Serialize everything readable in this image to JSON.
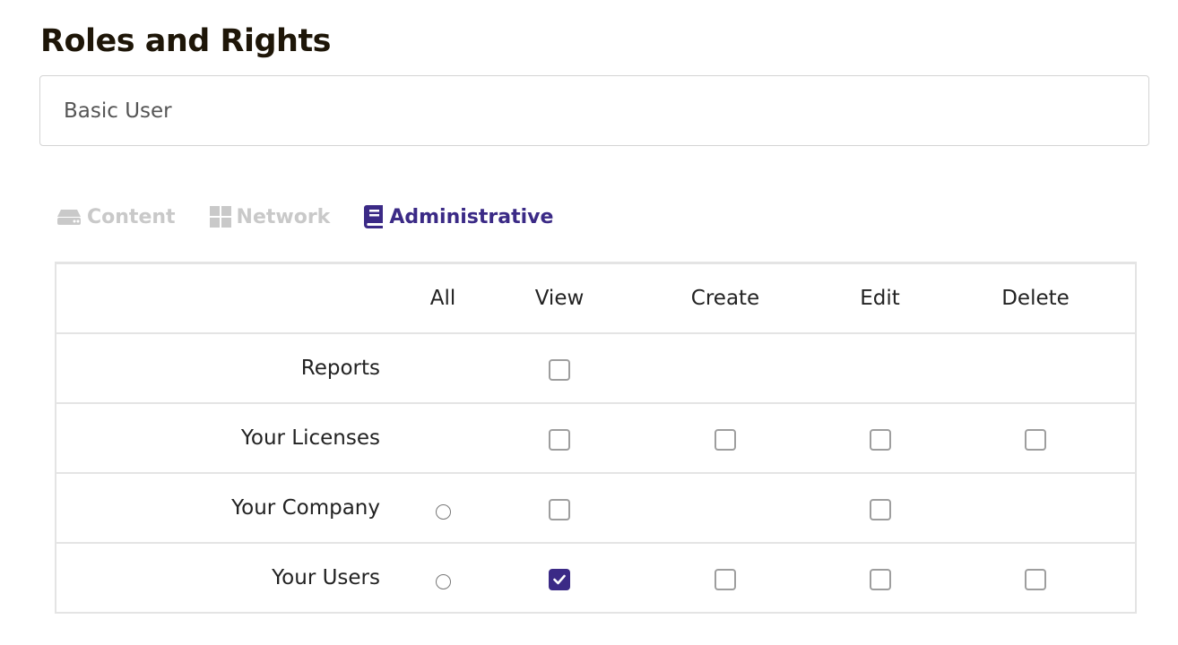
{
  "page": {
    "title": "Roles and Rights"
  },
  "role": {
    "value": "Basic User"
  },
  "tabs": [
    {
      "label": "Content",
      "icon": "hard-drive-icon",
      "active": false
    },
    {
      "label": "Network",
      "icon": "grid-icon",
      "active": false
    },
    {
      "label": "Administrative",
      "icon": "book-icon",
      "active": true
    }
  ],
  "colors": {
    "accent": "#3b2a86",
    "inactive_tab": "#c9c9c9",
    "title": "#1e1608"
  },
  "permissions": {
    "columns": [
      "All",
      "View",
      "Create",
      "Edit",
      "Delete"
    ],
    "rows": [
      {
        "label": "Reports",
        "all": null,
        "view": {
          "checked": false
        },
        "create": null,
        "edit": null,
        "delete": null
      },
      {
        "label": "Your Licenses",
        "all": null,
        "view": {
          "checked": false
        },
        "create": {
          "checked": false
        },
        "edit": {
          "checked": false
        },
        "delete": {
          "checked": false
        }
      },
      {
        "label": "Your Company",
        "all": {
          "selected": false
        },
        "view": {
          "checked": false
        },
        "create": null,
        "edit": {
          "checked": false
        },
        "delete": null
      },
      {
        "label": "Your Users",
        "all": {
          "selected": false
        },
        "view": {
          "checked": true
        },
        "create": {
          "checked": false
        },
        "edit": {
          "checked": false
        },
        "delete": {
          "checked": false
        }
      }
    ]
  }
}
